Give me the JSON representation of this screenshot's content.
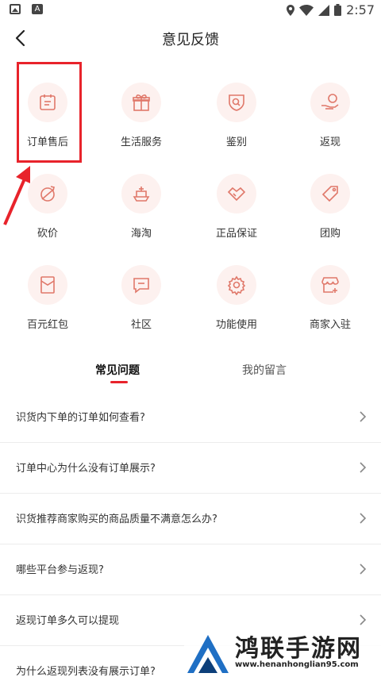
{
  "status_bar": {
    "time": "2:57"
  },
  "header": {
    "title": "意见反馈"
  },
  "categories": [
    {
      "label": "订单售后",
      "icon": "order-icon"
    },
    {
      "label": "生活服务",
      "icon": "gift-icon"
    },
    {
      "label": "鉴别",
      "icon": "shield-search-icon"
    },
    {
      "label": "返现",
      "icon": "cashback-icon"
    },
    {
      "label": "砍价",
      "icon": "bargain-icon"
    },
    {
      "label": "海淘",
      "icon": "ship-icon"
    },
    {
      "label": "正品保证",
      "icon": "handshake-icon"
    },
    {
      "label": "团购",
      "icon": "tag-icon"
    },
    {
      "label": "百元红包",
      "icon": "red-packet-icon"
    },
    {
      "label": "社区",
      "icon": "chat-icon"
    },
    {
      "label": "功能使用",
      "icon": "gear-icon"
    },
    {
      "label": "商家入驻",
      "icon": "store-icon"
    }
  ],
  "tabs": [
    {
      "label": "常见问题",
      "active": true
    },
    {
      "label": "我的留言",
      "active": false
    }
  ],
  "faq": [
    "识货内下单的订单如何查看?",
    "订单中心为什么没有订单展示?",
    "识货推荐商家购买的商品质量不满意怎么办?",
    "哪些平台参与返现?",
    "返现订单多久可以提现",
    "为什么返现列表没有展示订单?"
  ],
  "watermark": {
    "title": "鸿联手游网",
    "url": "www.henanhonglian95.com"
  },
  "colors": {
    "accent": "#e8232b",
    "icon_bg": "#fdf1ef",
    "icon_stroke": "#e0786a"
  }
}
